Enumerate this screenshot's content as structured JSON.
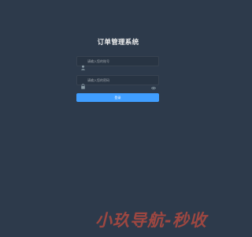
{
  "login": {
    "title": "订单管理系统",
    "username": {
      "placeholder": "请输入您的账号",
      "value": "",
      "icon": "user-icon"
    },
    "password": {
      "placeholder": "请输入您的密码",
      "value": "",
      "icon": "lock-icon",
      "toggle_icon": "eye-icon"
    },
    "submit_label": "登录"
  },
  "watermark": {
    "text": "小玖导航-秒收"
  },
  "colors": {
    "background": "#2d3a4b",
    "input_background": "#283443",
    "button": "#409eff",
    "watermark": "#e8503b"
  }
}
